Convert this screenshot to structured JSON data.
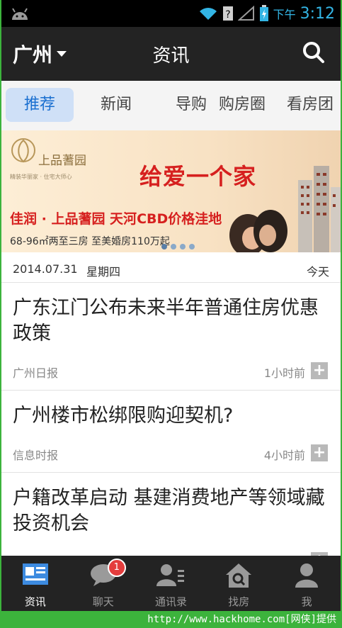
{
  "status_bar": {
    "ampm": "下午",
    "clock": "3:12"
  },
  "title_bar": {
    "city": "广州",
    "title": "资讯"
  },
  "tabs": [
    {
      "label": "推荐",
      "active": true
    },
    {
      "label": "新闻",
      "active": false
    },
    {
      "label": "导购",
      "active": false
    },
    {
      "label": "购房圈",
      "active": false
    },
    {
      "label": "看房团",
      "active": false
    }
  ],
  "banner": {
    "brand": "上品蓍园",
    "brand_sub": "精装华丽家 · 住宅大师心",
    "slogan": "给爱一个家",
    "line1": "佳润 · 上品蓍园  天河CBD价格洼地",
    "line2": "68-96㎡两至三房  至美婚房110万起",
    "page_count": 4,
    "active_page": 1
  },
  "date_row": {
    "date": "2014.07.31",
    "weekday": "星期四",
    "today": "今天"
  },
  "articles": [
    {
      "headline": "广东江门公布未来半年普通住房优惠政策",
      "source": "广州日报",
      "time": "1小时前"
    },
    {
      "headline": "广州楼市松绑限购迎契机?",
      "source": "信息时报",
      "time": "4小时前"
    },
    {
      "headline": "户籍改革启动 基建消费地产等领域藏投资机会",
      "source": "",
      "time": ""
    }
  ],
  "bottom_nav": [
    {
      "label": "资讯",
      "icon": "news-icon",
      "active": true
    },
    {
      "label": "聊天",
      "icon": "chat-icon",
      "active": false,
      "badge": "1"
    },
    {
      "label": "通讯录",
      "icon": "contacts-icon",
      "active": false
    },
    {
      "label": "找房",
      "icon": "house-search-icon",
      "active": false
    },
    {
      "label": "我",
      "icon": "person-icon",
      "active": false
    }
  ],
  "watermark": "http://www.hackhome.com[网侠]提供",
  "colors": {
    "accent_blue": "#1a6fd0",
    "tab_active_bg": "#cfe0f7",
    "bar_dark": "#232323",
    "badge_red": "#e43d3d",
    "status_blue": "#33b5e5"
  }
}
